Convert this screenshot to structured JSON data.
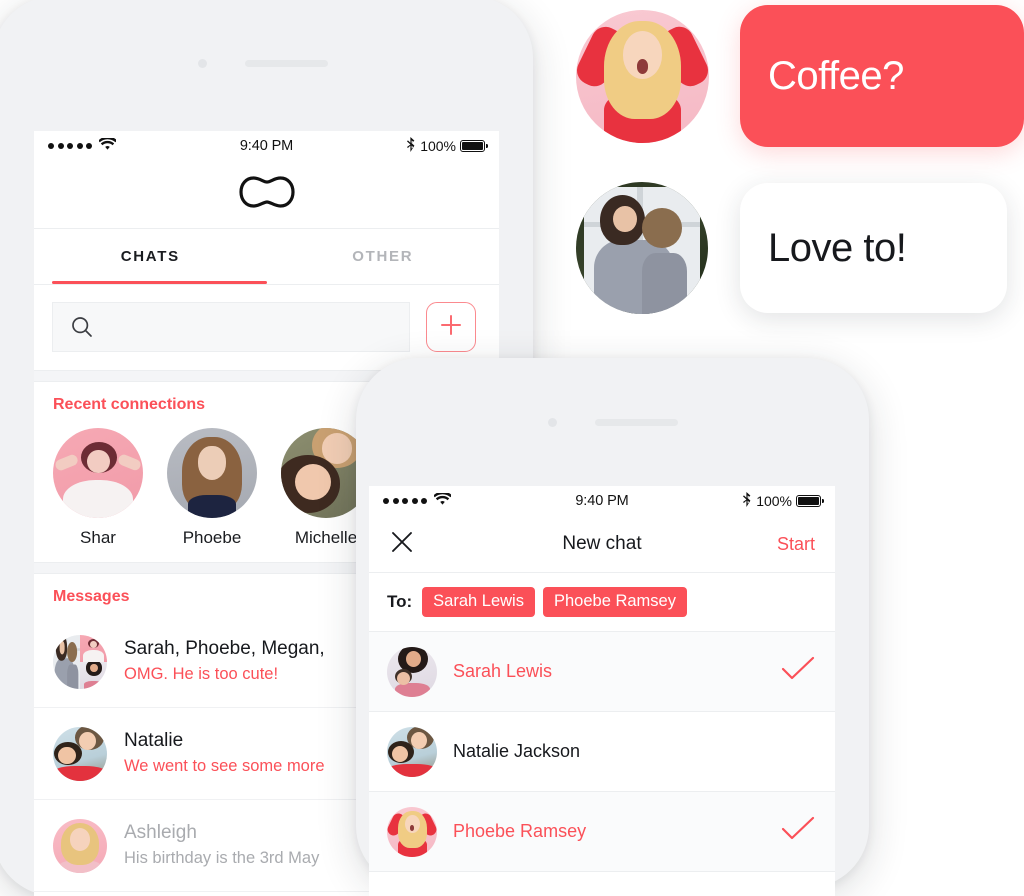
{
  "accent": "#fb5058",
  "phone_one": {
    "status_bar": {
      "signal_icon": "signal-dots-icon",
      "wifi_icon": "wifi-icon",
      "time": "9:40 PM",
      "bluetooth_icon": "bluetooth-icon",
      "battery_percent": "100%",
      "battery_icon": "battery-full-icon"
    },
    "app_logo": "peanut-logo-icon",
    "tabs": [
      {
        "label": "CHATS",
        "active": true
      },
      {
        "label": "OTHER",
        "active": false
      }
    ],
    "search": {
      "icon": "search-icon",
      "value": "",
      "placeholder": ""
    },
    "new_chat_button_icon": "plus-icon",
    "recent_connections": {
      "title": "Recent connections",
      "people": [
        {
          "name": "Shar",
          "avatar": "avatar-shar"
        },
        {
          "name": "Phoebe",
          "avatar": "avatar-phoebe"
        },
        {
          "name": "Michelle",
          "avatar": "avatar-michelle"
        }
      ]
    },
    "messages": {
      "title": "Messages",
      "items": [
        {
          "name": "Sarah, Phoebe, Megan,",
          "preview": "OMG. He is too cute!",
          "read": false,
          "avatar": "avatar-group-collage"
        },
        {
          "name": "Natalie",
          "preview": "We went to see some more",
          "read": false,
          "avatar": "avatar-natalie"
        },
        {
          "name": "Ashleigh",
          "preview": "His birthday is the 3rd May",
          "read": true,
          "avatar": "avatar-ashleigh"
        }
      ]
    }
  },
  "phone_two": {
    "status_bar": {
      "signal_icon": "signal-dots-icon",
      "wifi_icon": "wifi-icon",
      "time": "9:40 PM",
      "bluetooth_icon": "bluetooth-icon",
      "battery_percent": "100%",
      "battery_icon": "battery-full-icon"
    },
    "navbar": {
      "close_icon": "close-icon",
      "title": "New chat",
      "action_label": "Start"
    },
    "recipients": {
      "label": "To:",
      "chips": [
        "Sarah Lewis",
        "Phoebe Ramsey"
      ]
    },
    "contacts": [
      {
        "name": "Sarah Lewis",
        "selected": true,
        "avatar": "avatar-sarah-lewis"
      },
      {
        "name": "Natalie Jackson",
        "selected": false,
        "avatar": "avatar-natalie-jackson"
      },
      {
        "name": "Phoebe Ramsey",
        "selected": true,
        "avatar": "avatar-phoebe-ramsey"
      }
    ]
  },
  "floating_conversation": {
    "messages": [
      {
        "text": "Coffee?",
        "outgoing": true,
        "avatar": "avatar-surprised-blonde"
      },
      {
        "text": "Love to!",
        "outgoing": false,
        "avatar": "avatar-mother-child"
      }
    ]
  }
}
